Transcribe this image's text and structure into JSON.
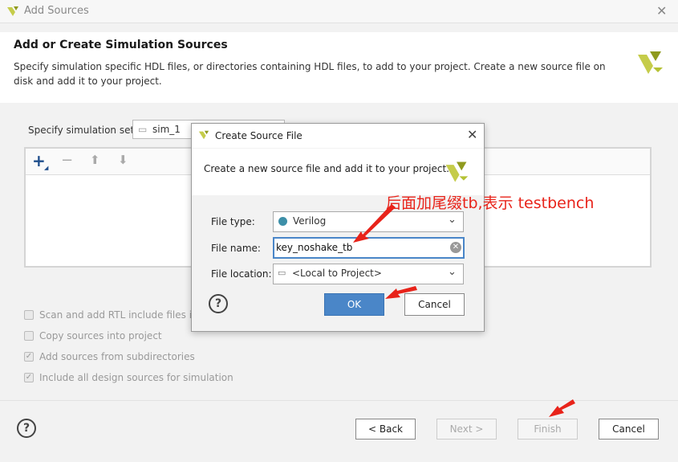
{
  "window": {
    "title": "Add Sources"
  },
  "header": {
    "heading": "Add or Create Simulation Sources",
    "description": "Specify simulation specific HDL files, or directories containing HDL files, to add to your project. Create a new source file on disk and add it to your project."
  },
  "simulation_set": {
    "label": "Specify simulation set:",
    "value": "sim_1"
  },
  "options": [
    {
      "label": "Scan and add RTL include files into project",
      "checked": false
    },
    {
      "label": "Copy sources into project",
      "checked": false
    },
    {
      "label": "Add sources from subdirectories",
      "checked": true
    },
    {
      "label": "Include all design sources for simulation",
      "checked": true
    }
  ],
  "footer": {
    "help": "?",
    "back": "< Back",
    "next": "Next >",
    "finish": "Finish",
    "cancel": "Cancel"
  },
  "dialog": {
    "title": "Create Source File",
    "description": "Create a new source file and add it to your project.",
    "file_type_label": "File type:",
    "file_type_value": "Verilog",
    "file_name_label": "File name:",
    "file_name_value": "key_noshake_tb",
    "file_location_label": "File location:",
    "file_location_value": "<Local to Project>",
    "help": "?",
    "ok": "OK",
    "cancel": "Cancel"
  },
  "annotation": {
    "text": "后面加尾缀tb,表示 testbench",
    "color": "#e8231a"
  },
  "colors": {
    "accent": "#4a86c8",
    "ok_button": "#4a86c8",
    "logo": "#b5c234",
    "annotation": "#e8231a"
  }
}
